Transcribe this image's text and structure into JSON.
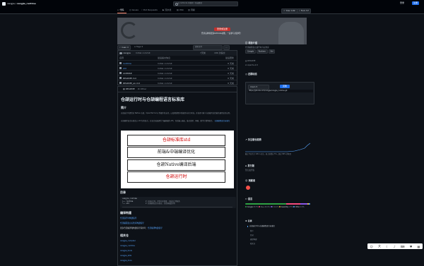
{
  "header": {
    "repo_owner": "cangjie",
    "repo_name": "cangjie_runtime",
    "search_placeholder": "在 GitCode 中搜索 / 快速跳转",
    "login": "登录",
    "register": "注册"
  },
  "tabs": [
    {
      "label": "代码"
    },
    {
      "label": "Issues"
    },
    {
      "label": "Pull Requests"
    },
    {
      "label": "流水线"
    },
    {
      "label": "Wiki"
    },
    {
      "label": "洞察"
    }
  ],
  "repo_actions": {
    "star": "Star",
    "star_count": "199",
    "fork": "Fork",
    "fork_count": "57"
  },
  "banner": {
    "button": "登录或注册",
    "text": "登录后体验更多GitCode功能，一起参与共建吧！"
  },
  "toolbar": {
    "branch": "main",
    "tags": "Tags",
    "search_placeholder": "搜索文件",
    "clone_button": "克隆",
    "clone_url": "https://gitcode.com/cangjie/cangjie_runtime.git"
  },
  "files": {
    "last_commit_author": "cangjie",
    "last_commit_message": "Initial commit",
    "last_commit_time": "7天前",
    "commit_count": "186 次提交",
    "header_name": "名称",
    "header_msg": "最后提交信息",
    "header_time": "最后更新",
    "rows": [
      {
        "name": "runtime",
        "msg": "Initial commit",
        "time": "8 天前"
      },
      {
        "name": "std",
        "msg": "Initial commit",
        "time": "8 天前"
      },
      {
        "name": "LICENSE",
        "msg": "Initial commit",
        "time": "8 天前"
      },
      {
        "name": "README.md",
        "msg": "Initial commit",
        "time": "8 天前"
      },
      {
        "name": "README_en.md",
        "msg": "Initial commit",
        "time": "8 天前"
      }
    ]
  },
  "readme": {
    "tab_readme": "README",
    "tab_other": "Other",
    "title": "仓颉运行时与仓颉编程语言标准库",
    "intro_heading": "简介",
    "intro_text_1": "仓颉运行时提供对 Native 仓颉、OpenHarmony 等操作的支持，以及帮助程序的编译与执行环境，开发者可基于仓颉编写高性能的通用业务应用。",
    "intro_text_2": "仓颉编程语言标准库以 std 包的形式，在语言层面提供了最基础的 API，包括输入输出、集合类型、网络、数学计算等能力。",
    "intro_link": "仓颉编程语言标准库",
    "diagram": [
      "仓颉标准库std",
      "前端&中端编译优化",
      "仓颉Native编译后端",
      "仓颉运行时"
    ],
    "toc_heading": "目录",
    "code_lines": [
      "cangjie_runtime",
      "├── runtime",
      "└── std"
    ],
    "code_comments": [
      "# 仓颉运行时，提供内存管理、并发执行等服务",
      "# 仓颉编程语言标准库，包括基础类型等"
    ],
    "build_heading": "编译构建",
    "build_links": [
      "仓颉运行时构建指导",
      "仓颉编程语言标准库构建指导"
    ],
    "build_note": "更多仓颉编译和构建指导请参考：",
    "build_note_link": "仓颉编译构建指导",
    "related_heading": "相关仓",
    "related_repos": [
      "cangjie_compiler",
      "cangjie_runtime",
      "cangjie_tools",
      "cangjie_stdx",
      "cangjie_docs"
    ]
  },
  "sidebar": {
    "about_heading": "项目介绍",
    "about_text": "仓颉编程语言运行时与标准库",
    "topics": [
      "Cangjie",
      "Runtime",
      "Std"
    ],
    "readme_label": "README",
    "license_label": "Apache-2.0",
    "activity_heading": "近期动态",
    "stars_heading": "关注增长趋势",
    "stars_text": "截止今日共计 199 人关注，较上周增长 5%，超过 86% 的项目",
    "release_heading": "发行版",
    "release_text": "暂无发行版",
    "contributors_heading": "贡献者",
    "languages_heading": "语言",
    "languages": [
      {
        "name": "Cangjie",
        "percent": "63.5%",
        "color": "#2ea043"
      },
      {
        "name": "C++",
        "percent": "20.9%",
        "color": "#f34b7d"
      },
      {
        "name": "C",
        "percent": "11.1%",
        "color": "#8957e5"
      },
      {
        "name": "Assembly",
        "percent": "2.5%",
        "color": "#e3b341"
      },
      {
        "name": "Other",
        "percent": "2.0%",
        "color": "#58a6ff"
      }
    ],
    "nav_heading": "目录",
    "nav_items": [
      "仓颉运行时与仓颉编程语言标准库",
      "简介",
      "目录",
      "编译构建",
      "相关仓"
    ]
  }
}
